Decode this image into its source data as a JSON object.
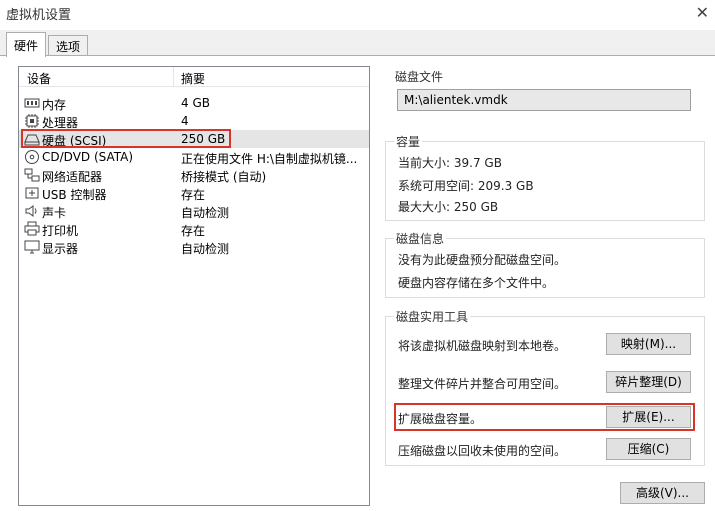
{
  "window": {
    "title": "虚拟机设置",
    "close_glyph": "✕"
  },
  "tabs": [
    {
      "label": "硬件"
    },
    {
      "label": "选项"
    }
  ],
  "devices": {
    "headers": {
      "device": "设备",
      "summary": "摘要"
    },
    "items": [
      {
        "name": "内存",
        "summary": "4 GB",
        "icon": "memory-icon"
      },
      {
        "name": "处理器",
        "summary": "4",
        "icon": "cpu-icon"
      },
      {
        "name": "硬盘 (SCSI)",
        "summary": "250 GB",
        "icon": "hard-disk-icon"
      },
      {
        "name": "CD/DVD (SATA)",
        "summary": "正在使用文件 H:\\自制虚拟机镜...",
        "icon": "cd-dvd-icon"
      },
      {
        "name": "网络适配器",
        "summary": "桥接模式 (自动)",
        "icon": "network-adapter-icon"
      },
      {
        "name": "USB 控制器",
        "summary": "存在",
        "icon": "usb-icon"
      },
      {
        "name": "声卡",
        "summary": "自动检测",
        "icon": "sound-card-icon"
      },
      {
        "name": "打印机",
        "summary": "存在",
        "icon": "printer-icon"
      },
      {
        "name": "显示器",
        "summary": "自动检测",
        "icon": "display-icon"
      }
    ],
    "selected_index": 2
  },
  "disk_file": {
    "title": "磁盘文件",
    "path": "M:\\alientek.vmdk"
  },
  "capacity": {
    "title": "容量",
    "current": "当前大小: 39.7 GB",
    "available": "系统可用空间: 209.3 GB",
    "max": "最大大小: 250 GB"
  },
  "disk_info": {
    "title": "磁盘信息",
    "line1": "没有为此硬盘预分配磁盘空间。",
    "line2": "硬盘内容存储在多个文件中。"
  },
  "disk_utilities": {
    "title": "磁盘实用工具",
    "map_desc": "将该虚拟机磁盘映射到本地卷。",
    "map_btn": "映射(M)...",
    "defrag_desc": "整理文件碎片并整合可用空间。",
    "defrag_btn": "碎片整理(D)",
    "expand_desc": "扩展磁盘容量。",
    "expand_btn": "扩展(E)...",
    "compact_desc": "压缩磁盘以回收未使用的空间。",
    "compact_btn": "压缩(C)"
  },
  "advanced_btn": "高级(V)...",
  "colors": {
    "highlight": "#d9342b",
    "selection": "#e5e5e5"
  }
}
